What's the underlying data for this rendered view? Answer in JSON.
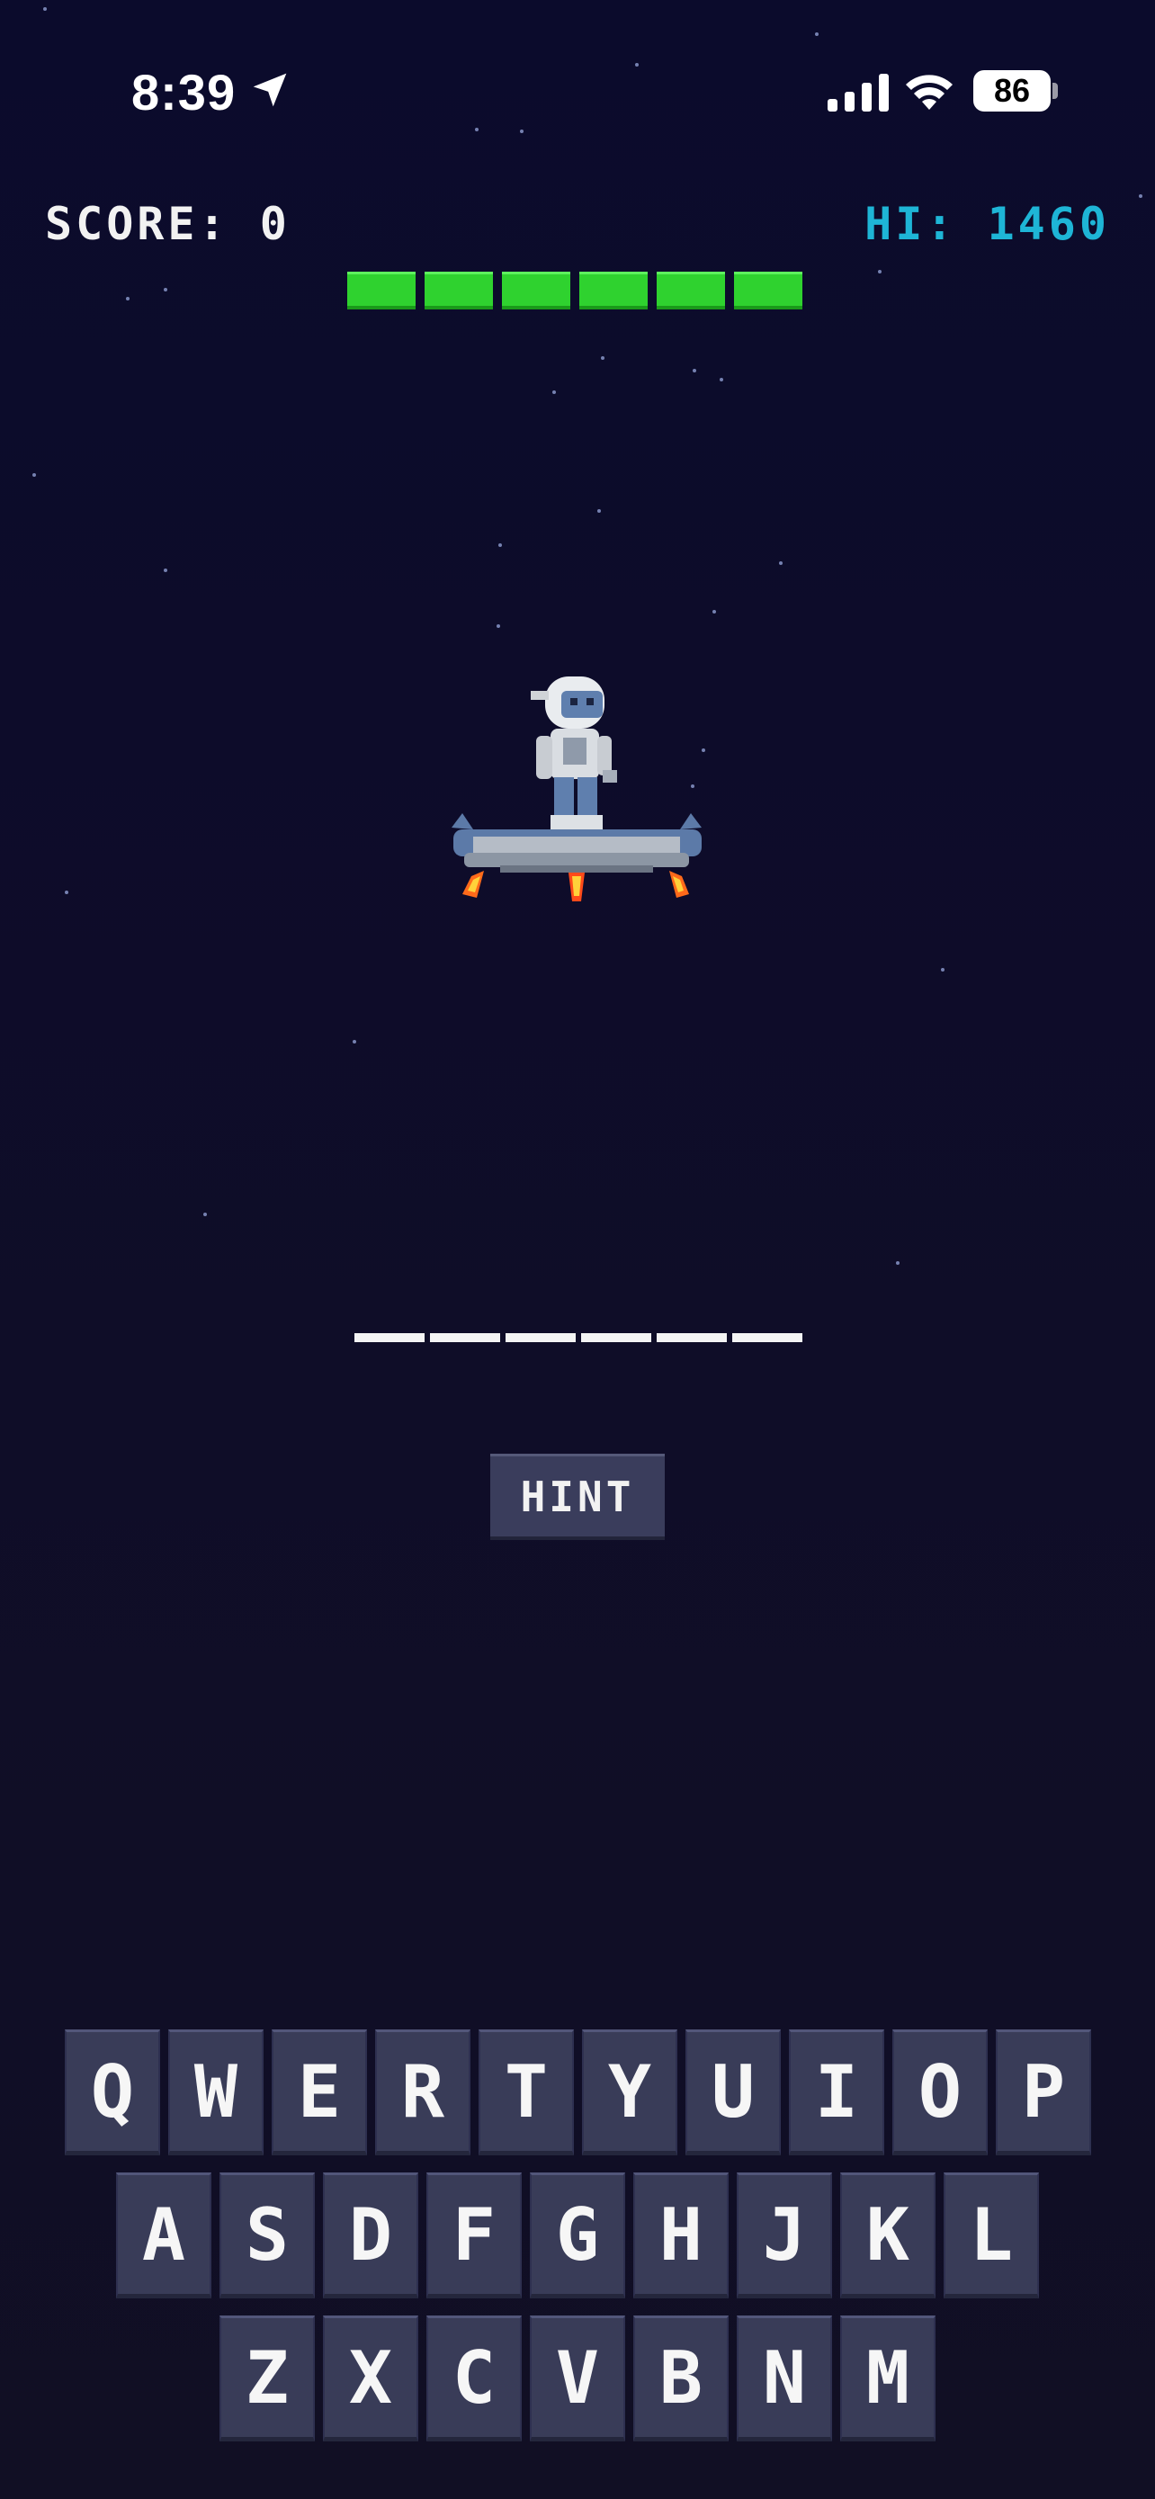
{
  "status_bar": {
    "time": "8:39",
    "battery": "86"
  },
  "hud": {
    "score_label": "SCORE:",
    "score_value": "0",
    "hi_label": "HI:",
    "hi_value": "1460",
    "lives": 6
  },
  "word": {
    "letters": 6
  },
  "hint_button": "HINT",
  "keyboard": {
    "row1": [
      "Q",
      "W",
      "E",
      "R",
      "T",
      "Y",
      "U",
      "I",
      "O",
      "P"
    ],
    "row2": [
      "A",
      "S",
      "D",
      "F",
      "G",
      "H",
      "J",
      "K",
      "L"
    ],
    "row3": [
      "Z",
      "X",
      "C",
      "V",
      "B",
      "N",
      "M"
    ]
  },
  "colors": {
    "background": "#0f0d28",
    "lives": "#2fd22f",
    "hi": "#1eb5d6",
    "key": "#393c58"
  },
  "icons": [
    "location-arrow-icon",
    "signal-icon",
    "wifi-icon",
    "battery-icon"
  ]
}
